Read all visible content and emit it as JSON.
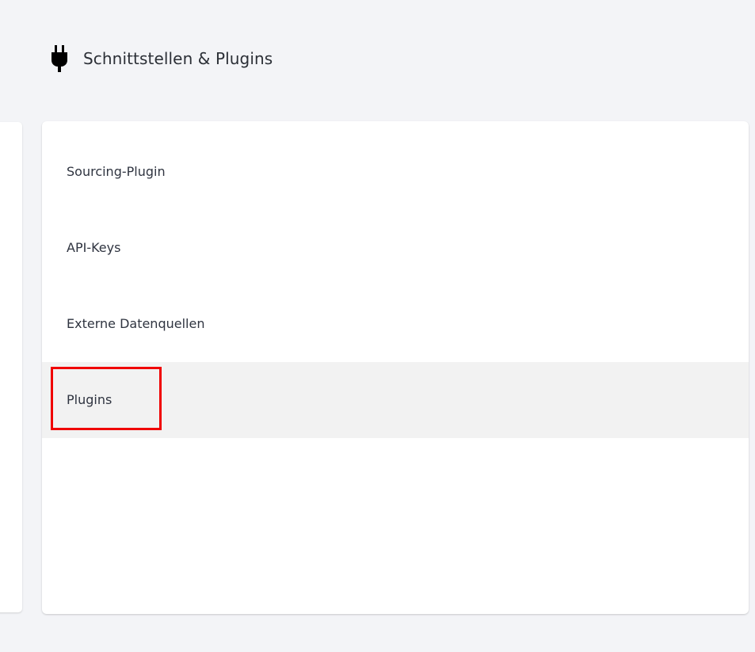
{
  "header": {
    "icon": "plug-icon",
    "title": "Schnittstellen & Plugins"
  },
  "menu": {
    "items": [
      {
        "label": "Sourcing-Plugin"
      },
      {
        "label": "API-Keys"
      },
      {
        "label": "Externe Datenquellen"
      },
      {
        "label": "Plugins",
        "active": true
      }
    ]
  },
  "colors": {
    "background": "#f3f4f7",
    "card": "#ffffff",
    "active_item": "#f2f2f2",
    "highlight": "#f00000",
    "text": "#2f3440"
  }
}
